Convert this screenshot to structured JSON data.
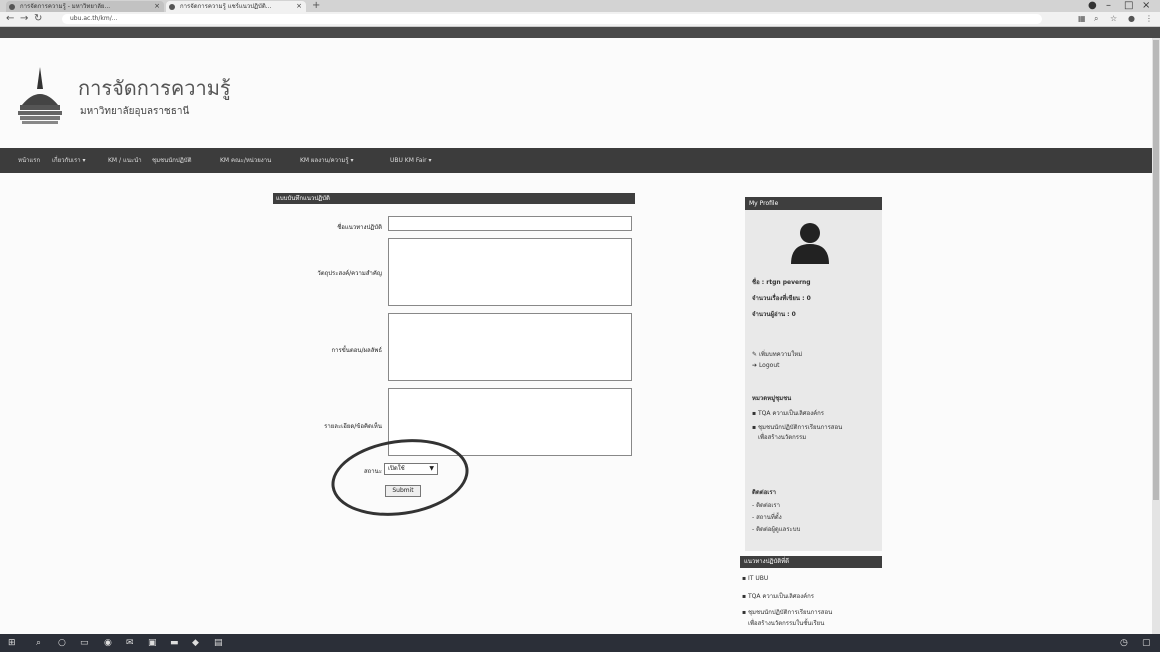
{
  "browser": {
    "tabs": [
      {
        "label": "การจัดการความรู้ - มหาวิทยาลัย..."
      },
      {
        "label": "การจัดการความรู้ แชร์แนวปฏิบัติ..."
      }
    ],
    "new_tab": "+",
    "url": "ubu.ac.th/km/..."
  },
  "site": {
    "title": "การจัดการความรู้",
    "subtitle": "มหาวิทยาลัยอุบลราชธานี",
    "nav": [
      "หน้าแรก",
      "เกี่ยวกับเรา ▾",
      "KM / แนะนำ",
      "ชุมชนนักปฏิบัติ",
      "KM คณะ/หน่วยงาน",
      "KM ผลงาน/ความรู้ ▾",
      "UBU KM Fair ▾"
    ]
  },
  "form": {
    "header": "แบบบันทึกแนวปฏิบัติ",
    "fields": [
      {
        "label": "ชื่อแนวทางปฏิบัติ"
      },
      {
        "label": "วัตถุประสงค์/ความสำคัญ"
      },
      {
        "label": "การขั้นตอน/ผลลัพธ์"
      },
      {
        "label": "รายละเอียด/ข้อคิดเห็น"
      }
    ],
    "status_label": "สถานะ",
    "status_value": "เปิดใช้",
    "submit_label": "Submit"
  },
  "profile": {
    "header": "My Profile",
    "lines": [
      "ชื่อ : rtgn peverng",
      "จำนวนเรื่องที่เขียน : 0",
      "จำนวนผู้อ่าน : 0"
    ],
    "links": [
      "เพิ่มบทความใหม่",
      "Logout"
    ],
    "group_title": "หมวดหมู่ชุมชน",
    "groups": [
      "TQA ความเป็นเลิศองค์กร",
      "ชุมชนนักปฏิบัติการเรียนการสอน",
      "เพื่อสร้างนวัตกรรม"
    ],
    "contact_title": "ติดต่อเรา",
    "contact": [
      "- ติดต่อเรา",
      "- สถานที่ตั้ง",
      "- ติดต่อผู้ดูแลระบบ"
    ]
  },
  "sidebar2": {
    "header": "แนวทางปฏิบัติที่ดี",
    "items": [
      "IT UBU",
      "TQA ความเป็นเลิศองค์กร",
      "ชุมชนนักปฏิบัติการเรียนการสอน",
      "เพื่อสร้างนวัตกรรมในชั้นเรียน"
    ]
  },
  "colors": {
    "dark": "#3c3c3c",
    "accent": "#4a4a4a"
  }
}
